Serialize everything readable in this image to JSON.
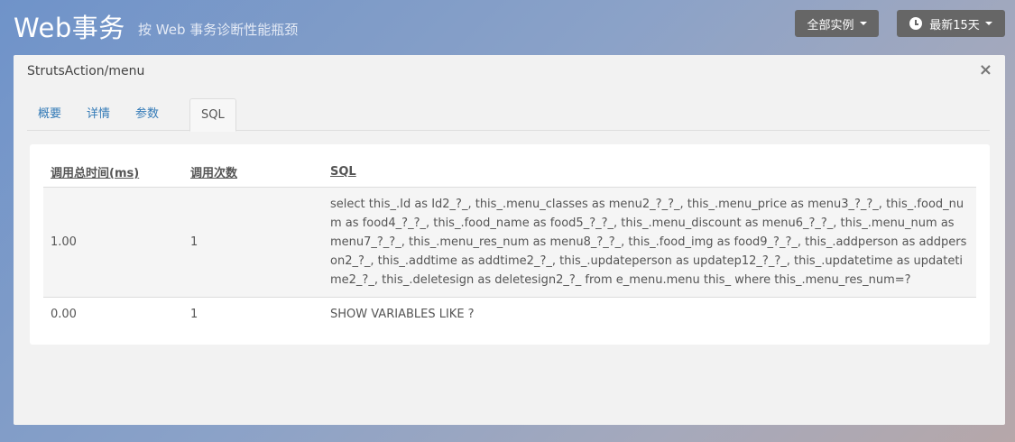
{
  "header": {
    "title": "Web事务",
    "subtitle": "按 Web 事务诊断性能瓶颈",
    "instances_label": "全部实例",
    "period_label": "最新15天"
  },
  "modal": {
    "title": "StrutsAction/menu",
    "close": "×",
    "tabs": [
      "概要",
      "详情",
      "参数",
      "SQL"
    ],
    "active_tab": "SQL"
  },
  "table": {
    "headers": [
      "调用总时间(ms)",
      "调用次数",
      "SQL"
    ],
    "rows": [
      {
        "time": "1.00",
        "count": "1",
        "sql": "select this_.Id as Id2_?_, this_.menu_classes as menu2_?_?_, this_.menu_price as menu3_?_?_, this_.food_num as food4_?_?_, this_.food_name as food5_?_?_, this_.menu_discount as menu6_?_?_, this_.menu_num as menu7_?_?_, this_.menu_res_num as menu8_?_?_, this_.food_img as food9_?_?_, this_.addperson as addperson2_?_, this_.addtime as addtime2_?_, this_.updateperson as updatep12_?_?_, this_.updatetime as updatetime2_?_, this_.deletesign as deletesign2_?_ from e_menu.menu this_ where this_.menu_res_num=?"
      },
      {
        "time": "0.00",
        "count": "1",
        "sql": "SHOW VARIABLES LIKE ?"
      }
    ]
  }
}
